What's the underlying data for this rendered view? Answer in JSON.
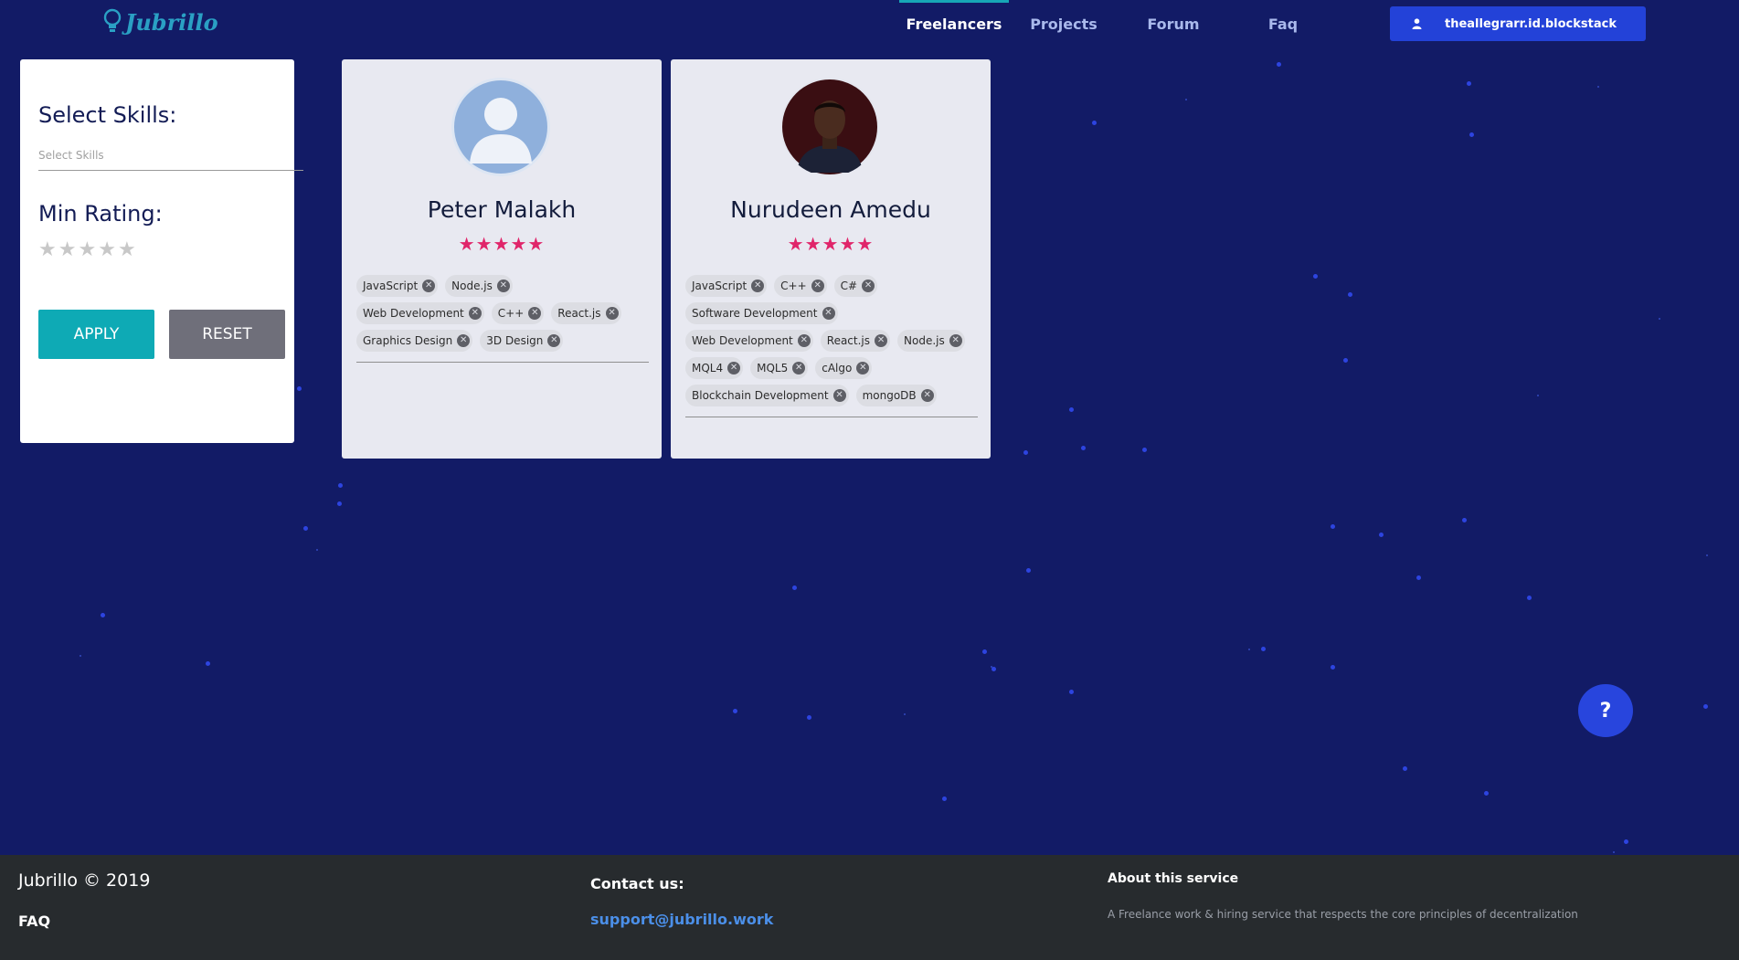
{
  "header": {
    "logo_text": "Jubrillo",
    "nav": [
      {
        "label": "Freelancers",
        "active": true
      },
      {
        "label": "Projects",
        "active": false
      },
      {
        "label": "Forum",
        "active": false
      },
      {
        "label": "Faq",
        "active": false
      }
    ],
    "user": {
      "name": "theallegrarr.id.blockstack",
      "icon": "user-icon"
    }
  },
  "filter": {
    "skills_title": "Select Skills:",
    "skills_placeholder": "Select Skills",
    "rating_title": "Min Rating:",
    "rating_value": 0,
    "rating_max": 5,
    "apply_label": "APPLY",
    "reset_label": "RESET"
  },
  "freelancers": [
    {
      "name": "Peter Malakh",
      "rating": 5,
      "avatar": "default-avatar-icon",
      "skills": [
        "JavaScript",
        "Node.js",
        "Web Development",
        "C++",
        "React.js",
        "Graphics Design",
        "3D Design"
      ]
    },
    {
      "name": "Nurudeen Amedu",
      "rating": 5,
      "avatar": "profile-photo",
      "skills": [
        "JavaScript",
        "C++",
        "C#",
        "Software Development",
        "Web Development",
        "React.js",
        "Node.js",
        "MQL4",
        "MQL5",
        "cAlgo",
        "Blockchain Development",
        "mongoDB"
      ]
    }
  ],
  "help_button": {
    "label": "?"
  },
  "footer": {
    "copyright": "Jubrillo © 2019",
    "faq": "FAQ",
    "contact_title": "Contact us:",
    "contact_email": "support@jubrillo.work",
    "about_title": "About this service",
    "about_desc": "A Freelance work & hiring service that respects the core principles of decentralization"
  },
  "colors": {
    "background": "#121b66",
    "accent": "#0eaab5",
    "primary_button": "#2342d8",
    "star_rating": "#e0256a",
    "footer": "#272b2e"
  }
}
